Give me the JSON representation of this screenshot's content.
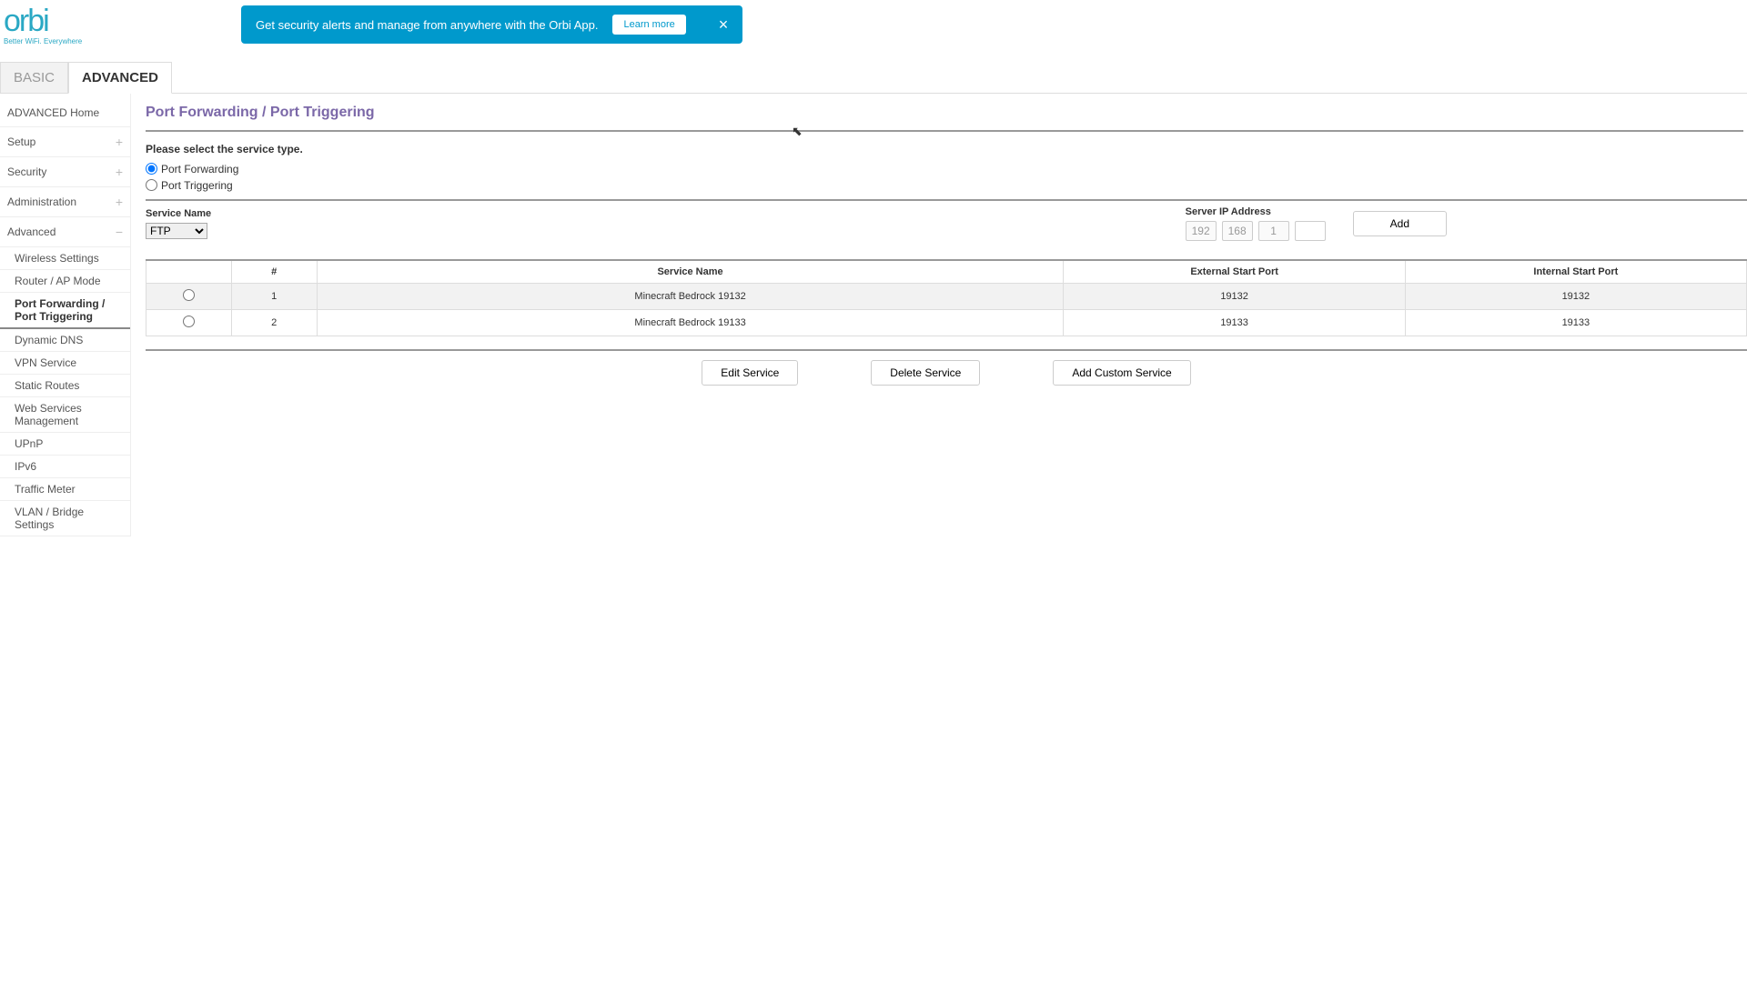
{
  "logo": {
    "main": "orbi",
    "sub": "Better WiFi. Everywhere"
  },
  "banner": {
    "text": "Get security alerts and manage from anywhere with the Orbi App.",
    "learn": "Learn more",
    "close": "×"
  },
  "tabs": {
    "basic": "BASIC",
    "advanced": "ADVANCED"
  },
  "sidebar": {
    "home": "ADVANCED Home",
    "setup": "Setup",
    "security": "Security",
    "administration": "Administration",
    "advanced": "Advanced",
    "plus": "+",
    "minus": "−",
    "subs": {
      "wireless": "Wireless Settings",
      "router_ap": "Router / AP Mode",
      "port_fwd": "Port Forwarding / Port Triggering",
      "ddns": "Dynamic DNS",
      "vpn": "VPN Service",
      "static": "Static Routes",
      "web_svc": "Web Services Management",
      "upnp": "UPnP",
      "ipv6": "IPv6",
      "traffic": "Traffic Meter",
      "vlan": "VLAN / Bridge Settings"
    }
  },
  "page": {
    "title": "Port Forwarding / Port Triggering",
    "select_type": "Please select the service type.",
    "radio_fwd": "Port Forwarding",
    "radio_trig": "Port Triggering",
    "service_name_label": "Service Name",
    "service_name_value": "FTP",
    "server_ip_label": "Server IP Address",
    "ip": {
      "a": "192",
      "b": "168",
      "c": "1",
      "d": ""
    },
    "add_btn": "Add"
  },
  "table": {
    "headers": {
      "num": "#",
      "name": "Service Name",
      "ext": "External Start Port",
      "int": "Internal Start Port"
    },
    "rows": [
      {
        "num": "1",
        "name": "Minecraft Bedrock 19132",
        "ext": "19132",
        "int": "19132"
      },
      {
        "num": "2",
        "name": "Minecraft Bedrock 19133",
        "ext": "19133",
        "int": "19133"
      }
    ]
  },
  "actions": {
    "edit": "Edit Service",
    "delete": "Delete Service",
    "add_custom": "Add Custom Service"
  }
}
